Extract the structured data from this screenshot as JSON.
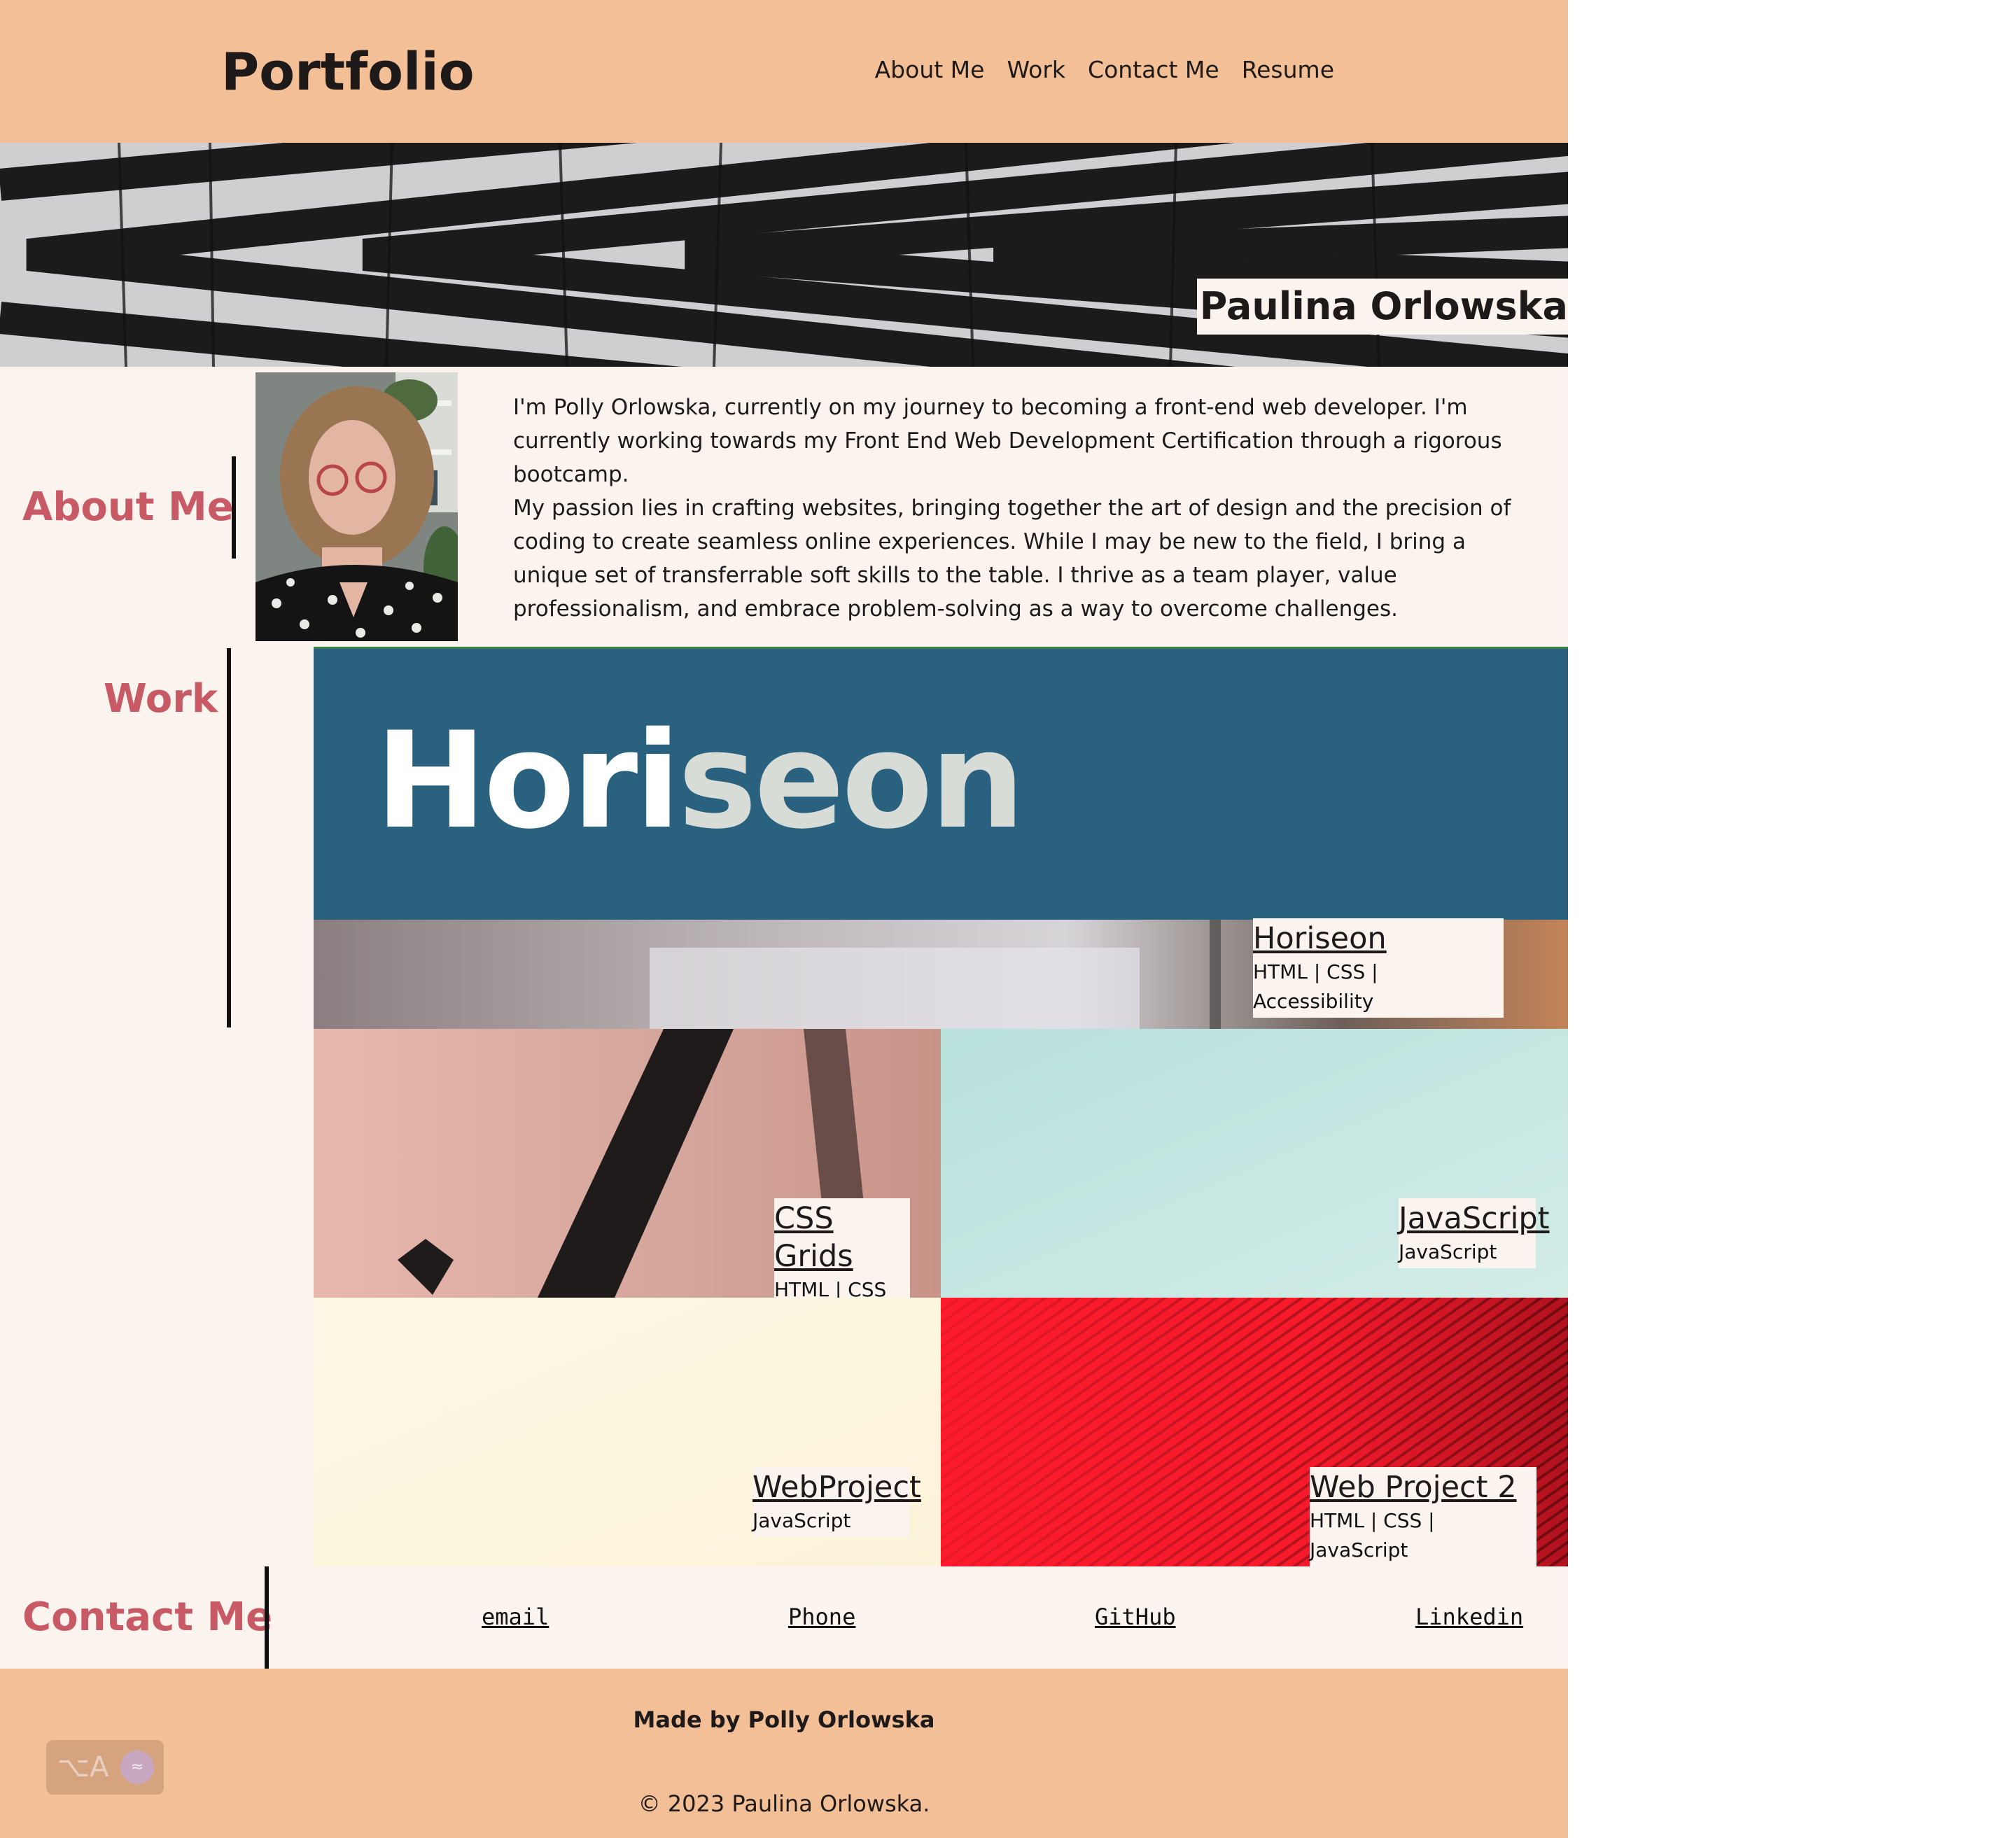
{
  "header": {
    "logo": "Portfolio",
    "nav": [
      "About Me",
      "Work",
      "Contact Me",
      "Resume"
    ]
  },
  "hero": {
    "name": "Paulina Orlowska"
  },
  "about": {
    "heading": "About Me",
    "paragraphs": [
      "I'm Polly Orlowska, currently on my journey to becoming a front-end web developer. I'm currently working towards my Front End Web Development Certification through a rigorous bootcamp.",
      "My passion lies in crafting websites, bringing together the art of design and the precision of coding to create seamless online experiences. While I may be new to the field, I bring a unique set of transferrable soft skills to the table. I thrive as a team player, value professionalism, and embrace problem-solving as a way to overcome challenges."
    ]
  },
  "work": {
    "heading": "Work",
    "featured": {
      "banner_text_a": "Hori",
      "banner_text_b": "seon",
      "title": "Horiseon",
      "tags": "HTML | CSS | Accessibility"
    },
    "projects": [
      {
        "title": "CSS Grids",
        "tags": "HTML | CSS"
      },
      {
        "title": "JavaScript",
        "tags": "JavaScript"
      },
      {
        "title": "WebProject",
        "tags": "JavaScript"
      },
      {
        "title": "Web Project 2",
        "tags": "HTML | CSS | JavaScript"
      }
    ]
  },
  "contact": {
    "heading": "Contact Me",
    "links": [
      "email",
      "Phone",
      "GitHub",
      "Linkedin"
    ]
  },
  "footer": {
    "made_by": "Made by Polly Orlowska",
    "copyright": "© 2023 Paulina Orlowska."
  },
  "widget": {
    "glyph": "⌥A",
    "icon": "audio-icon"
  },
  "colors": {
    "header_bg": "#f3bf96",
    "page_bg": "#faf3ee",
    "heading_accent": "#c85a66",
    "horiseon_banner": "#2a617f"
  }
}
